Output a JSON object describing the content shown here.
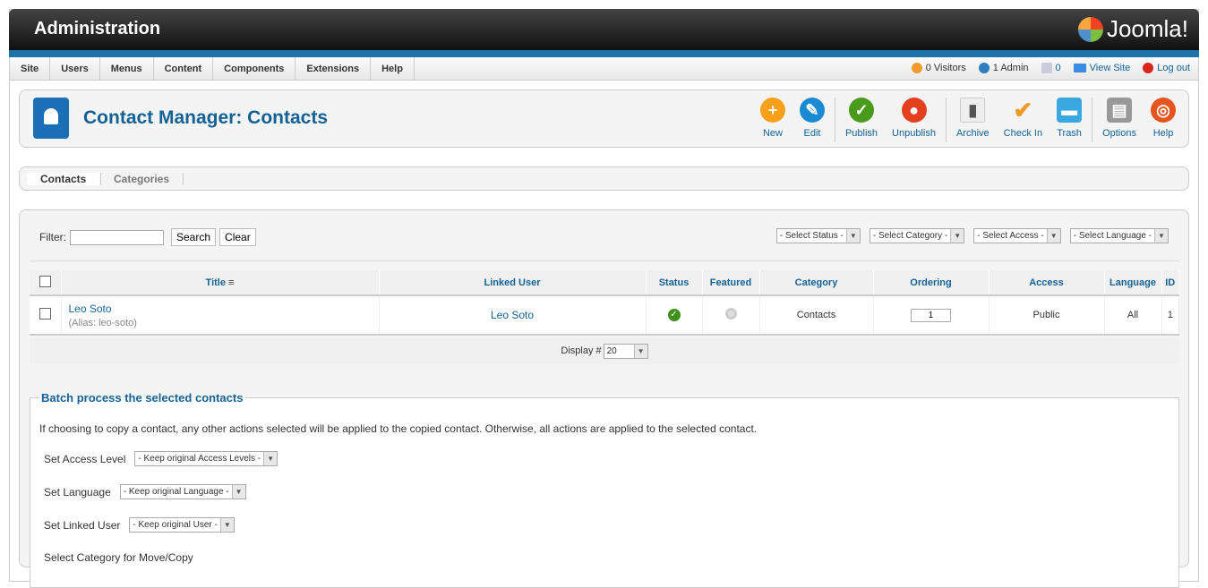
{
  "header": {
    "title": "Administration",
    "logo": "Joomla!"
  },
  "menu": [
    "Site",
    "Users",
    "Menus",
    "Content",
    "Components",
    "Extensions",
    "Help"
  ],
  "status": {
    "visitors": "0 Visitors",
    "admin": "1 Admin",
    "messages": "0",
    "view_site": "View Site",
    "logout": "Log out"
  },
  "page": {
    "title": "Contact Manager: Contacts",
    "icon": "contacts-icon"
  },
  "toolbar": [
    {
      "label": "New",
      "color": "#f9a01b",
      "icon": "plus-icon"
    },
    {
      "label": "Edit",
      "color": "#1b8ad3",
      "icon": "pencil-icon"
    },
    {
      "label": "Publish",
      "color": "#4a9a1c",
      "icon": "check-icon"
    },
    {
      "label": "Unpublish",
      "color": "#e3401f",
      "icon": "circle-icon"
    },
    {
      "label": "Archive",
      "color": "#eeeeee",
      "icon": "archive-icon"
    },
    {
      "label": "Check In",
      "color": "#f09a2c",
      "icon": "checkmark-icon"
    },
    {
      "label": "Trash",
      "color": "#3aa8e0",
      "icon": "trash-icon"
    },
    {
      "label": "Options",
      "color": "#999999",
      "icon": "options-icon"
    },
    {
      "label": "Help",
      "color": "#e3541f",
      "icon": "lifebuoy-icon"
    }
  ],
  "tabs": [
    "Contacts",
    "Categories"
  ],
  "filter": {
    "label": "Filter:",
    "value": "",
    "search": "Search",
    "clear": "Clear"
  },
  "selects": [
    "- Select Status -",
    "- Select Category -",
    "- Select Access -",
    "- Select Language -"
  ],
  "table": {
    "headers": [
      "Title",
      "Linked User",
      "Status",
      "Featured",
      "Category",
      "Ordering",
      "Access",
      "Language",
      "ID"
    ],
    "rows": [
      {
        "title": "Leo Soto",
        "alias": "(Alias: leo-soto)",
        "linked_user": "Leo Soto",
        "status": "published",
        "featured": false,
        "category": "Contacts",
        "ordering": "1",
        "access": "Public",
        "language": "All",
        "id": "1"
      }
    ]
  },
  "display": {
    "label": "Display #",
    "value": "20"
  },
  "batch": {
    "legend": "Batch process the selected contacts",
    "note": "If choosing to copy a contact, any other actions selected will be applied to the copied contact. Otherwise, all actions are applied to the selected contact.",
    "access_label": "Set Access Level",
    "access_value": "- Keep original Access Levels -",
    "language_label": "Set Language",
    "language_value": "- Keep original Language -",
    "user_label": "Set Linked User",
    "user_value": "- Keep original User -",
    "category_label": "Select Category for Move/Copy"
  }
}
